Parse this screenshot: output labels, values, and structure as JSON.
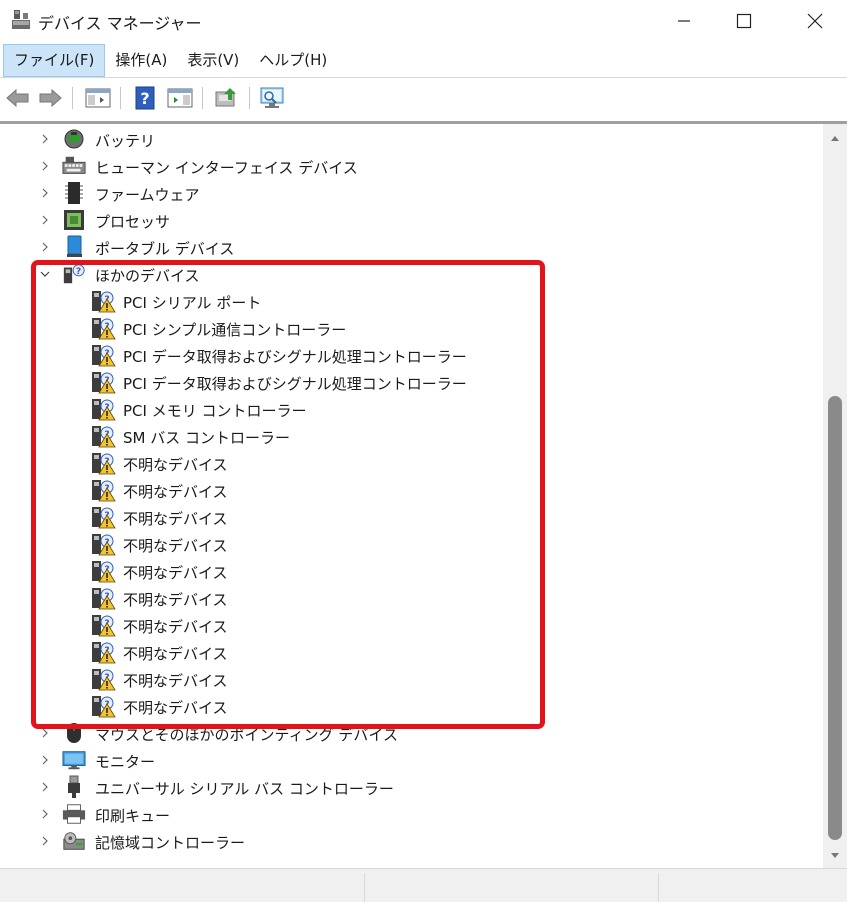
{
  "window": {
    "title": "デバイス マネージャー",
    "app_icon": "device-manager-icon",
    "controls": [
      "minimize-icon",
      "maximize-icon",
      "close-icon"
    ]
  },
  "menu": {
    "items": [
      {
        "label": "ファイル(F)",
        "active": true
      },
      {
        "label": "操作(A)",
        "active": false
      },
      {
        "label": "表示(V)",
        "active": false
      },
      {
        "label": "ヘルプ(H)",
        "active": false
      }
    ]
  },
  "toolbar": {
    "buttons": [
      "back-icon",
      "forward-icon",
      "show-hide-console-tree-icon",
      "help-icon",
      "action-pane-icon",
      "update-driver-icon",
      "scan-hardware-icon"
    ]
  },
  "tree": {
    "categories_top": [
      {
        "label": "バッテリ",
        "icon": "battery-icon"
      },
      {
        "label": "ヒューマン インターフェイス デバイス",
        "icon": "hid-icon"
      },
      {
        "label": "ファームウェア",
        "icon": "firmware-icon"
      },
      {
        "label": "プロセッサ",
        "icon": "processor-icon"
      },
      {
        "label": "ポータブル デバイス",
        "icon": "portable-device-icon"
      }
    ],
    "expanded_category": {
      "label": "ほかのデバイス",
      "icon": "other-devices-icon"
    },
    "devices": [
      "PCI シリアル ポート",
      "PCI シンプル通信コントローラー",
      "PCI データ取得およびシグナル処理コントローラー",
      "PCI データ取得およびシグナル処理コントローラー",
      "PCI メモリ コントローラー",
      "SM バス コントローラー",
      "不明なデバイス",
      "不明なデバイス",
      "不明なデバイス",
      "不明なデバイス",
      "不明なデバイス",
      "不明なデバイス",
      "不明なデバイス",
      "不明なデバイス",
      "不明なデバイス",
      "不明なデバイス"
    ],
    "device_icon": "unknown-device-warning-icon",
    "categories_bottom": [
      {
        "label": "マウスとそのほかのポインティング デバイス",
        "icon": "mouse-icon"
      },
      {
        "label": "モニター",
        "icon": "monitor-icon"
      },
      {
        "label": "ユニバーサル シリアル バス コントローラー",
        "icon": "usb-icon"
      },
      {
        "label": "印刷キュー",
        "icon": "printer-icon"
      },
      {
        "label": "記憶域コントローラー",
        "icon": "storage-controller-icon"
      }
    ]
  },
  "colors": {
    "highlight": "#e3131b",
    "menu_active_bg": "#cce4f7",
    "warning": "#f4c430"
  }
}
